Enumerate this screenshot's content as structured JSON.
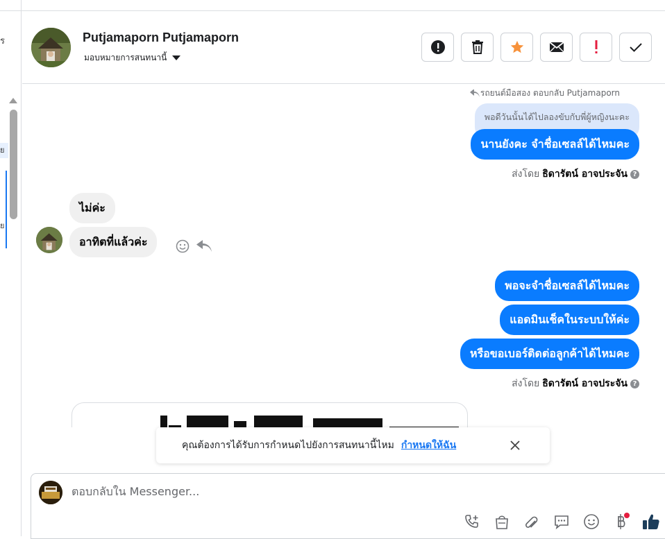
{
  "left_panel": {
    "fragment_top": "ร",
    "fragment_mid": "ย",
    "fragment_low": "ย"
  },
  "header": {
    "contact_name": "Putjamaporn Putjamaporn",
    "assign_label": "มอบหมายการสนทนานี้",
    "actions": [
      {
        "name": "alert-button",
        "icon": "alert-circle-icon"
      },
      {
        "name": "delete-button",
        "icon": "trash-icon"
      },
      {
        "name": "star-button",
        "icon": "star-icon",
        "color": "#f7923b"
      },
      {
        "name": "mark-unread-button",
        "icon": "envelope-icon"
      },
      {
        "name": "important-button",
        "icon": "exclamation-icon",
        "color": "#e41e3f"
      },
      {
        "name": "done-button",
        "icon": "check-icon"
      }
    ]
  },
  "conversation": {
    "reply_context": "รถยนต์มือสอง ตอบกลับ Putjamaporn",
    "quoted_message": "พอดีวันนั้นได้ไปลองขับกับพี่ผู้หญิงนะคะ",
    "msg_out_1": "นานยังคะ จำชื่อเซลล์ได้ไหมคะ",
    "sent_by_prefix": "ส่งโดย",
    "sent_by_name": "ธิดารัตน์ อาจประจัน",
    "msg_in_1": "ไม่ค่ะ",
    "msg_in_2": "อาทิตที่แล้วค่ะ",
    "msg_out_2": "พอจะจำชื่อเซลล์ได้ไหมคะ",
    "msg_out_3": "แอดมินเช็คในระบบให้ค่ะ",
    "msg_out_4": "หรือขอเบอร์ติดต่อลูกค้าได้ไหมคะ",
    "sent_by_prefix_2": "ส่งโดย",
    "sent_by_name_2": "ธิดารัตน์ อาจประจัน"
  },
  "toast": {
    "text": "คุณต้องการได้รับการกำหนดไปยังการสนทนานี้ไหม",
    "link": "กำหนดให้ฉัน"
  },
  "composer": {
    "placeholder": "ตอบกลับใน Messenger...",
    "accent": "#1877f2"
  }
}
